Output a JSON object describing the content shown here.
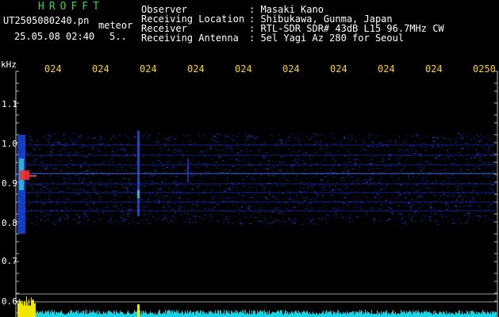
{
  "header": {
    "app_name": "HROFFT",
    "filename": "UT2505080240.pn",
    "tag": "meteor",
    "datetime": "25.05.08 02:40",
    "extra": "5..",
    "info_labels": [
      "Observer",
      "Receiving Location",
      "Receiver",
      "Receiving Antenna"
    ],
    "info_values": [
      ": Masaki Kano",
      ": Shibukawa, Gunma, Japan",
      ": RTL-SDR SDR# 43dB L15 96.7MHz CW",
      ": 5el Yagi Az 280 for Seoul"
    ]
  },
  "axis": {
    "unit": "kHz",
    "y_ticks": [
      "1.1",
      "1.0",
      "0.9",
      "0.8",
      "0.7",
      "0.6"
    ],
    "time_labels": [
      "024",
      "024",
      "024",
      "024",
      "024",
      "024",
      "024",
      "024",
      "024",
      "0250"
    ]
  },
  "colors": {
    "header_green": "#3cd24a",
    "label_yellow": "#ffd21e",
    "signal_blue": "#1e3cff",
    "bottom_cyan": "#19d2e6",
    "bottom_yellow": "#f0e600"
  }
}
